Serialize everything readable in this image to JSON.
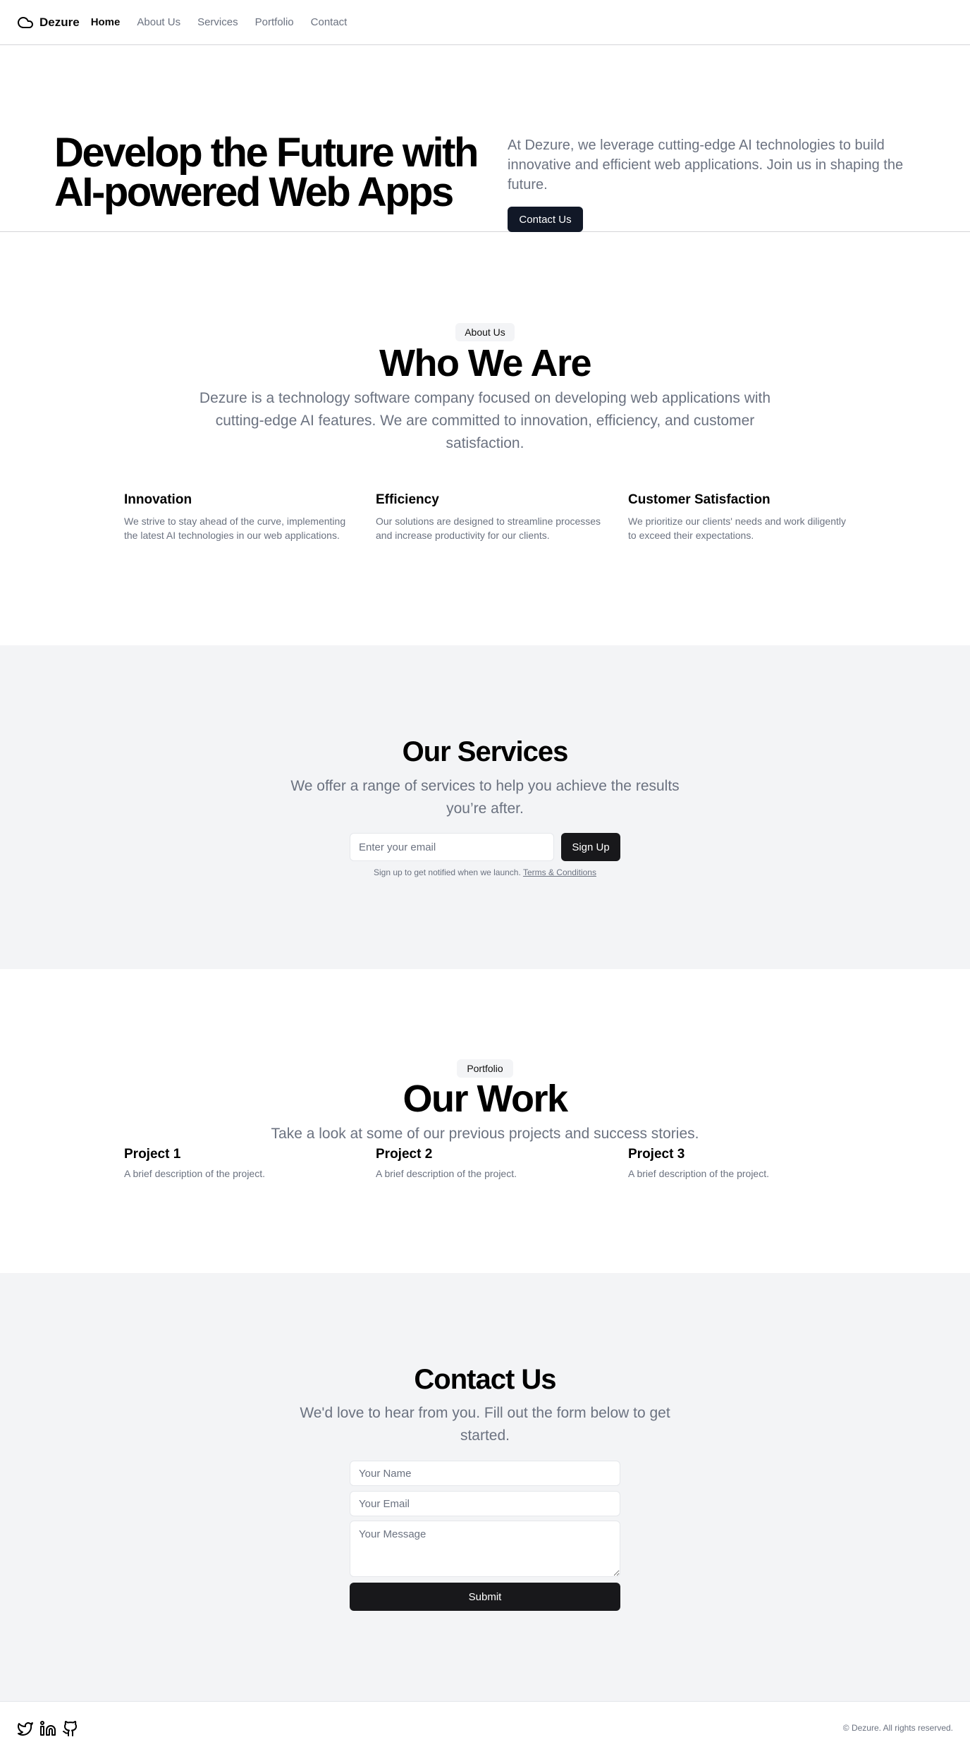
{
  "header": {
    "brand": "Dezure",
    "brand_icon": "cloud-icon",
    "nav": [
      {
        "label": "Home",
        "active": true
      },
      {
        "label": "About Us",
        "active": false
      },
      {
        "label": "Services",
        "active": false
      },
      {
        "label": "Portfolio",
        "active": false
      },
      {
        "label": "Contact",
        "active": false
      }
    ]
  },
  "hero": {
    "title_line1": "Develop the Future with",
    "title_line2": "AI-powered Web Apps",
    "description": "At Dezure, we leverage cutting-edge AI technologies to build innovative and efficient web applications. Join us in shaping the future.",
    "cta_label": "Contact Us"
  },
  "about": {
    "badge": "About Us",
    "title": "Who We Are",
    "description": "Dezure is a technology software company focused on developing web applications with cutting-edge AI features. We are committed to innovation, efficiency, and customer satisfaction.",
    "features": [
      {
        "title": "Innovation",
        "description": "We strive to stay ahead of the curve, implementing the latest AI technologies in our web applications."
      },
      {
        "title": "Efficiency",
        "description": "Our solutions are designed to streamline processes and increase productivity for our clients."
      },
      {
        "title": "Customer Satisfaction",
        "description": "We prioritize our clients' needs and work diligently to exceed their expectations."
      }
    ]
  },
  "services": {
    "title": "Our Services",
    "description": "We offer a range of services to help you achieve the results you’re after.",
    "email_placeholder": "Enter your email",
    "signup_label": "Sign Up",
    "note": "Sign up to get notified when we launch.",
    "terms_label": "Terms & Conditions"
  },
  "portfolio": {
    "badge": "Portfolio",
    "title": "Our Work",
    "description": "Take a look at some of our previous projects and success stories.",
    "projects": [
      {
        "title": "Project 1",
        "description": "A brief description of the project."
      },
      {
        "title": "Project 2",
        "description": "A brief description of the project."
      },
      {
        "title": "Project 3",
        "description": "A brief description of the project."
      }
    ]
  },
  "contact": {
    "title": "Contact Us",
    "description": "We'd love to hear from you. Fill out the form below to get started.",
    "name_placeholder": "Your Name",
    "email_placeholder": "Your Email",
    "message_placeholder": "Your Message",
    "submit_label": "Submit"
  },
  "footer": {
    "socials": [
      "twitter-icon",
      "linkedin-icon",
      "github-icon"
    ],
    "copyright": "© Dezure. All rights reserved."
  },
  "colors": {
    "primary_button": "#111827",
    "muted_text": "#6b7280",
    "section_gray": "#f3f4f6"
  }
}
